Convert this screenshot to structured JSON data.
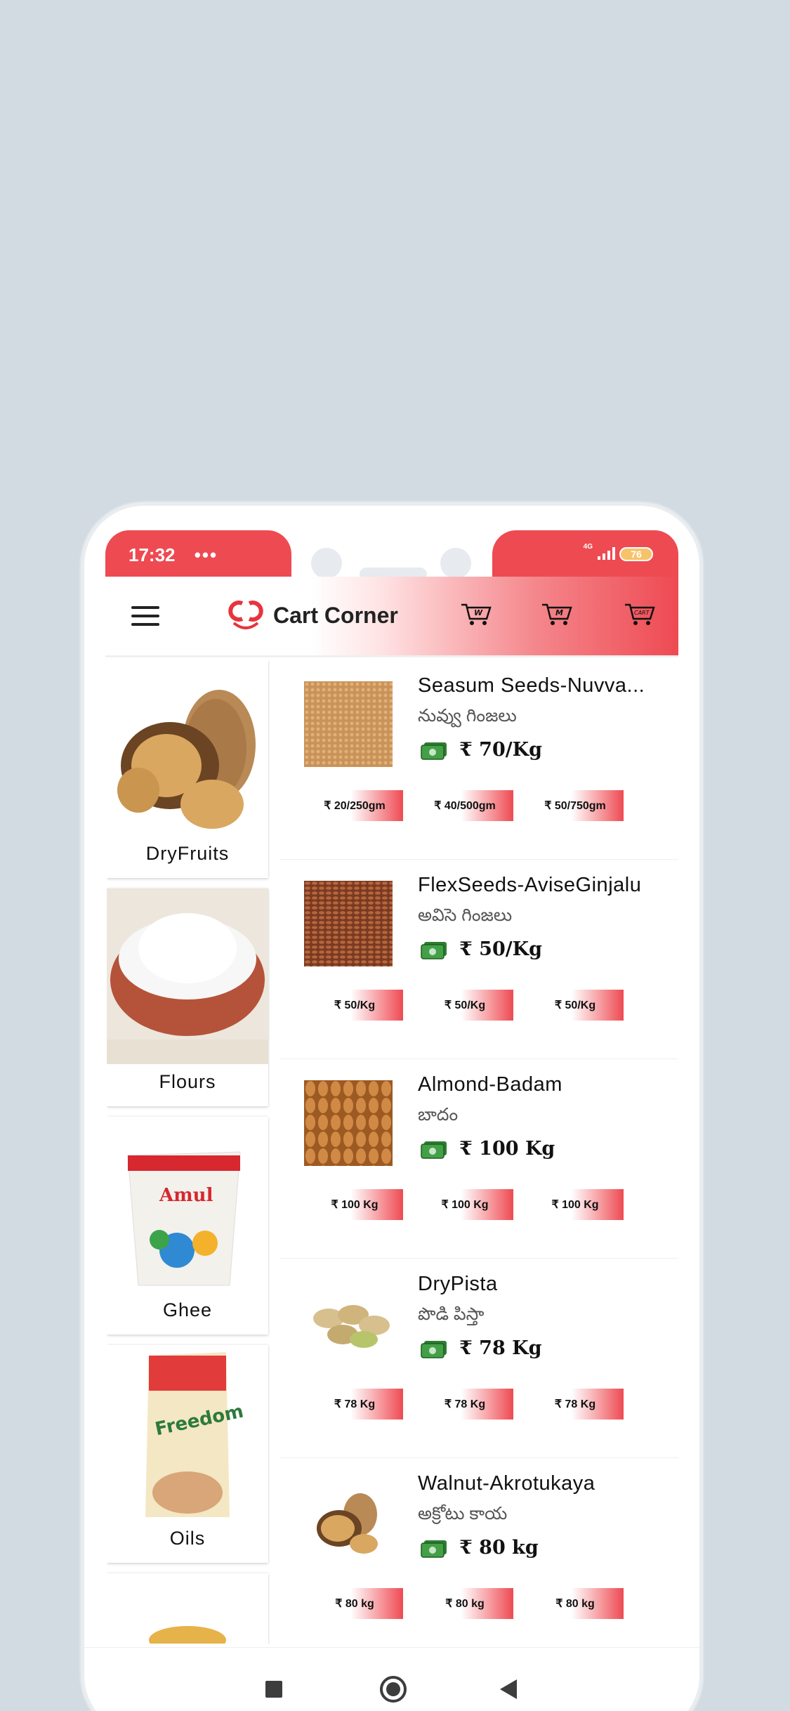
{
  "status_bar": {
    "time": "17:32",
    "dots": "•••",
    "network": "4G",
    "battery": "76"
  },
  "header": {
    "brand": "Cart Corner",
    "carts": [
      "W",
      "M",
      "CART"
    ]
  },
  "categories": [
    {
      "label": "DryFruits"
    },
    {
      "label": "Flours"
    },
    {
      "label": "Ghee"
    },
    {
      "label": "Oils"
    },
    {
      "label": ""
    }
  ],
  "products": [
    {
      "name": "Seasum Seeds-Nuvva...",
      "local": "నువ్వు గింజలు",
      "price": "₹ 70/Kg",
      "options": [
        "₹ 20/250gm",
        "₹ 40/500gm",
        "₹ 50/750gm"
      ]
    },
    {
      "name": "FlexSeeds-AviseGinjalu",
      "local": "అవిసె గింజలు",
      "price": "₹ 50/Kg",
      "options": [
        "₹ 50/Kg",
        "₹ 50/Kg",
        "₹ 50/Kg"
      ]
    },
    {
      "name": "Almond-Badam",
      "local": "బాదం",
      "price": "₹ 100 Kg",
      "options": [
        "₹ 100 Kg",
        "₹ 100 Kg",
        "₹ 100 Kg"
      ]
    },
    {
      "name": "DryPista",
      "local": "పొడి పిస్తా",
      "price": "₹ 78 Kg",
      "options": [
        "₹ 78 Kg",
        "₹ 78 Kg",
        "₹ 78 Kg"
      ]
    },
    {
      "name": "Walnut-Akrotukaya",
      "local": "అక్రోటు కాయ",
      "price": "₹ 80 kg",
      "options": [
        "₹ 80 kg",
        "₹ 80 kg",
        "₹ 80 kg"
      ]
    }
  ],
  "icons": {
    "menu": "hamburger-icon",
    "money": "cash-icon",
    "cart": "shopping-cart-icon",
    "nav": [
      "recents-icon",
      "home-icon",
      "back-icon"
    ]
  },
  "colors": {
    "accent": "#ee4a52",
    "background": "#d3dbe2"
  }
}
